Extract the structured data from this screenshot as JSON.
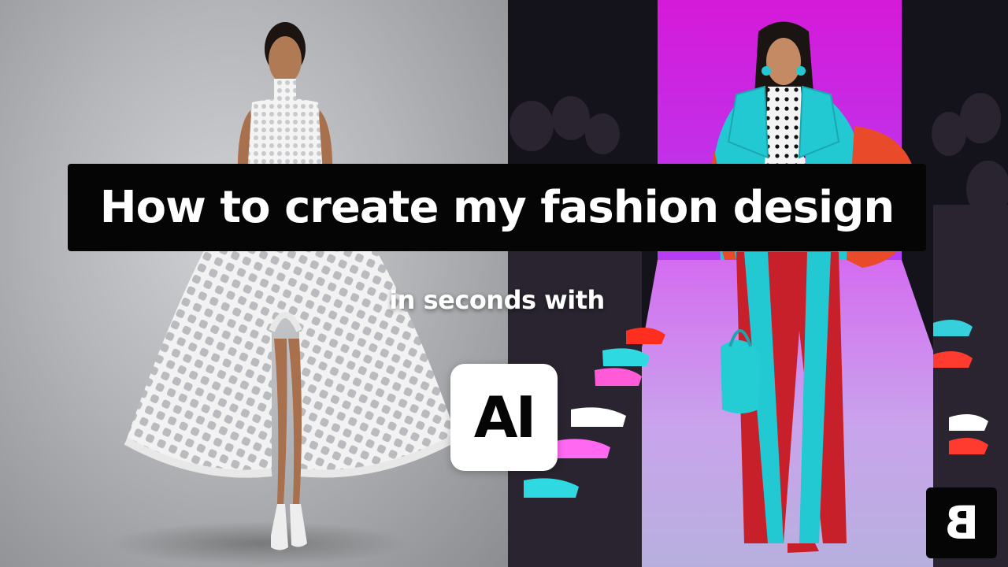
{
  "title": "How to create my fashion design",
  "subtitle": "in seconds with",
  "badge": "AI",
  "brand_logo": "B",
  "panels": [
    {
      "name": "studio-photo",
      "description_icon": "model-in-white-mesh-dress"
    },
    {
      "name": "runway-photo",
      "description_icon": "model-in-turquoise-red-coat-on-runway"
    }
  ],
  "colors": {
    "banner_bg": "#050505",
    "banner_text": "#ffffff",
    "badge_bg": "#ffffff",
    "badge_text": "#050505",
    "runway_magenta": "#c23cf0",
    "coat_turquoise": "#22c8d2",
    "coat_red": "#c8202a"
  }
}
